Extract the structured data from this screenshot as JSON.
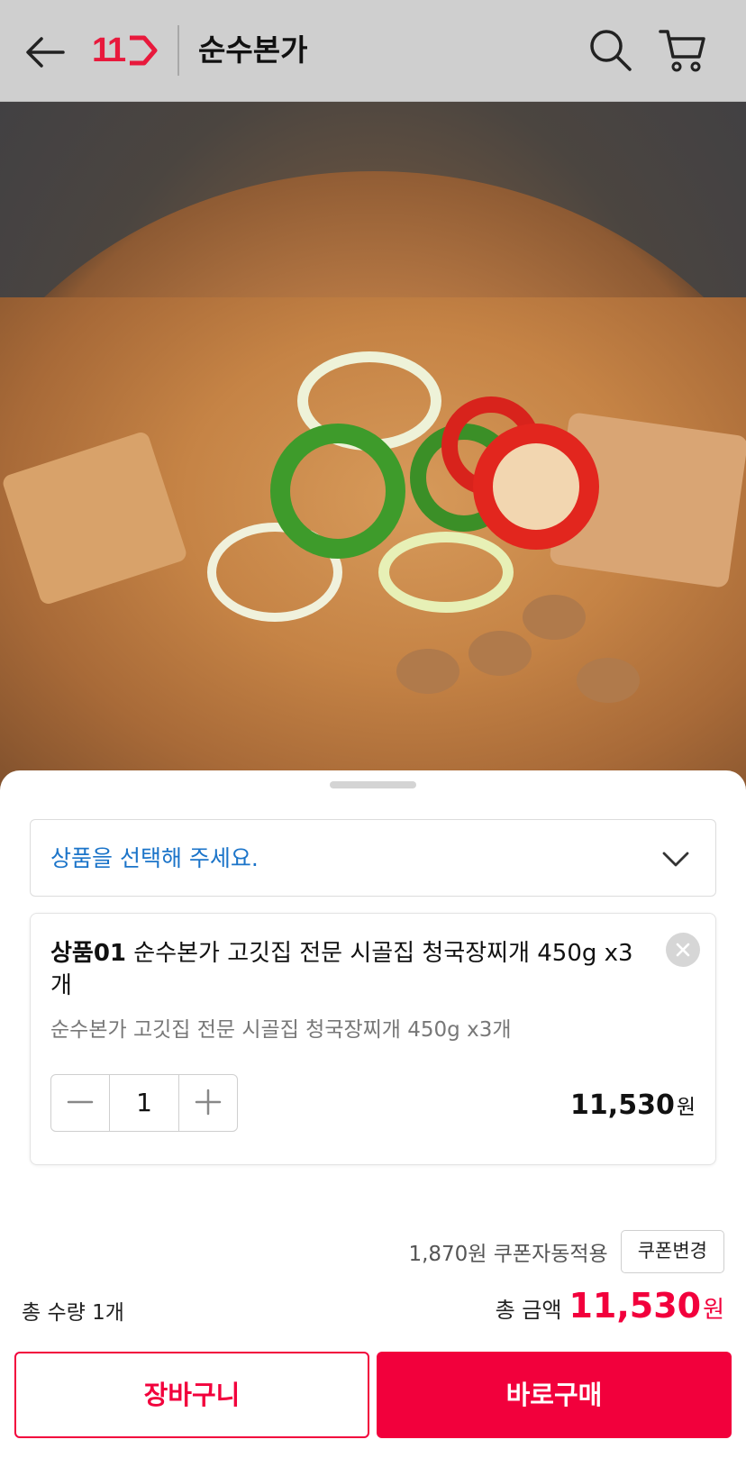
{
  "header": {
    "logo_text": "11",
    "store_name": "순수본가"
  },
  "product_image": {
    "description_icon": "stew-photo"
  },
  "sheet": {
    "select_placeholder": "상품을 선택해 주세요.",
    "option": {
      "prefix": "상품01",
      "title": " 순수본가 고깃집 전문 시골집 청국장찌개 450g x3개",
      "subtitle": "순수본가 고깃집 전문 시골집 청국장찌개 450g x3개",
      "quantity": "1",
      "price": "11,530",
      "currency": "원"
    },
    "coupon": {
      "text": "1,870원 쿠폰자동적용",
      "button": "쿠폰변경"
    },
    "total_quantity": "총 수량 1개",
    "total_label": "총 금액",
    "total_value": "11,530",
    "total_currency": "원",
    "cart_button": "장바구니",
    "buy_button": "바로구매"
  },
  "colors": {
    "accent": "#f2003c",
    "link_blue": "#1b74c9",
    "appbar_bg": "#cfcfcf"
  }
}
